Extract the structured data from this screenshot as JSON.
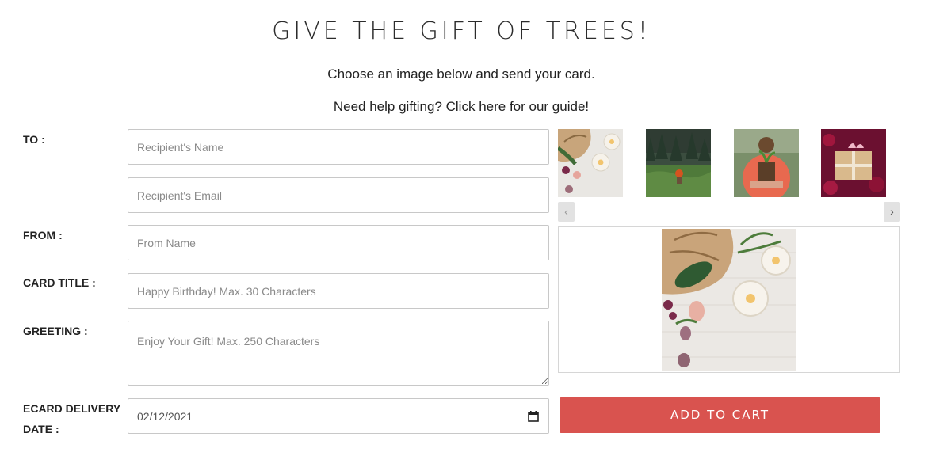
{
  "header": {
    "title": "GIVE THE GIFT OF TREES!",
    "subtitle": "Choose an image below and send your card.",
    "help_prefix": "Need help gifting? Click ",
    "help_link": "here",
    "help_suffix": " for our guide!"
  },
  "form": {
    "to_label": "TO :",
    "from_label": "FROM :",
    "card_title_label": "CARD TITLE :",
    "greeting_label": "GREETING :",
    "delivery_label_line1": "ECARD DELIVERY",
    "delivery_label_line2": "DATE :",
    "recipient_name_placeholder": "Recipient's Name",
    "recipient_email_placeholder": "Recipient's Email",
    "from_name_placeholder": "From Name",
    "card_title_placeholder": "Happy Birthday! Max. 30 Characters",
    "greeting_placeholder": "Enjoy Your Gift! Max. 250 Characters",
    "delivery_date_value": "02/12/2021"
  },
  "gallery": {
    "prev_label": "‹",
    "next_label": "›",
    "thumbnails": [
      "gift-candles-image",
      "forest-planting-image",
      "seedling-hands-image",
      "gift-box-image"
    ]
  },
  "actions": {
    "add_to_cart_label": "ADD TO CART"
  },
  "colors": {
    "accent": "#d9534f"
  }
}
